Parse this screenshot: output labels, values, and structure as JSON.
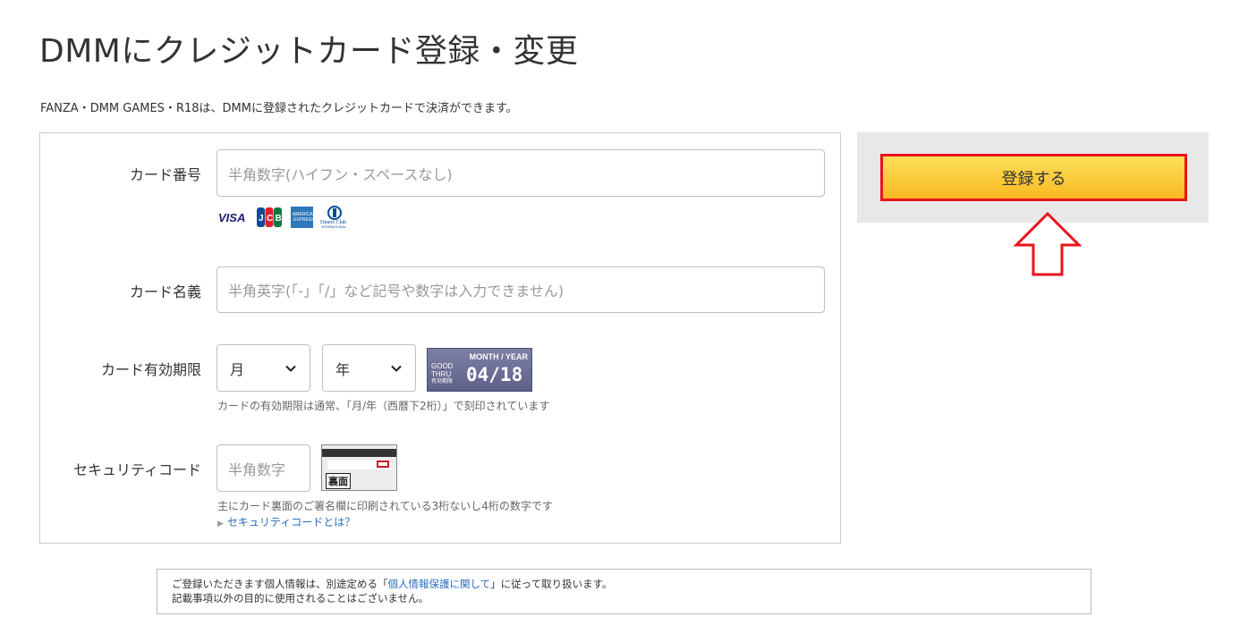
{
  "page": {
    "title": "DMMにクレジットカード登録・変更",
    "subtitle": "FANZA・DMM GAMES・R18は、DMMに登録されたクレジットカードで決済ができます。"
  },
  "form": {
    "card_number": {
      "label": "カード番号",
      "placeholder": "半角数字(ハイフン・スペースなし)",
      "brands": [
        "VISA",
        "JCB",
        "AMERICAN EXPRESS",
        "Diners Club INTERNATIONAL"
      ]
    },
    "card_name": {
      "label": "カード名義",
      "placeholder": "半角英字(「-」「/」など記号や数字は入力できません)"
    },
    "expiry": {
      "label": "カード有効期限",
      "month_value": "月",
      "year_value": "年",
      "sample": {
        "top": "MONTH / YEAR",
        "left_lines": [
          "GOOD",
          "THRU",
          "有効期限"
        ],
        "date": "04/18"
      },
      "note": "カードの有効期限は通常、「月/年（西暦下2桁）」で刻印されています"
    },
    "security": {
      "label": "セキュリティコード",
      "placeholder": "半角数字",
      "card_back_label": "裏面",
      "note": "主にカード裏面のご署名欄に印刷されている3桁ないし4桁の数字です",
      "link": "セキュリティコードとは？"
    }
  },
  "side": {
    "register_label": "登録する",
    "accent_color": "#e8141c"
  },
  "privacy": {
    "line1_before": "ご登録いただきます個人情報は、別途定める「",
    "line1_link": "個人情報保護に関して",
    "line1_after": "」に従って取り扱います。",
    "line2": "記載事項以外の目的に使用されることはございません。"
  }
}
